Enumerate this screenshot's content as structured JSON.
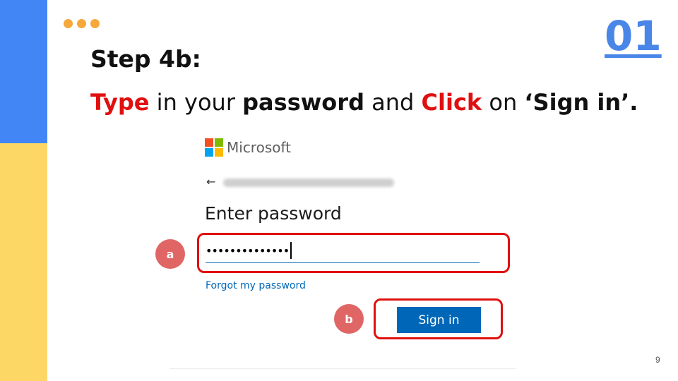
{
  "step_number": "01",
  "step_title": "Step 4b:",
  "instruction": {
    "w1": "Type",
    "w2": " in your ",
    "w3": "password",
    "w4": " and ",
    "w5": "Click",
    "w6": " on ",
    "w7": "‘Sign in’."
  },
  "signin_panel": {
    "brand": "Microsoft",
    "back_glyph": "←",
    "heading": "Enter password",
    "password_mask": "••••••••••••••",
    "forgot_link": "Forgot my password",
    "signin_button": "Sign in"
  },
  "callouts": {
    "a": "a",
    "b": "b"
  },
  "page_number": "9",
  "colors": {
    "accent_blue": "#4285f4",
    "accent_yellow": "#fdd766",
    "dots_orange": "#f6a83b",
    "highlight_red": "#e01010",
    "badge_red": "#e06666",
    "ms_blue": "#0067b8",
    "ms_logo": [
      "#f25022",
      "#7fba00",
      "#00a4ef",
      "#ffb900"
    ]
  },
  "icons": [
    "more-dots-icon",
    "microsoft-logo-icon",
    "back-arrow-icon"
  ]
}
